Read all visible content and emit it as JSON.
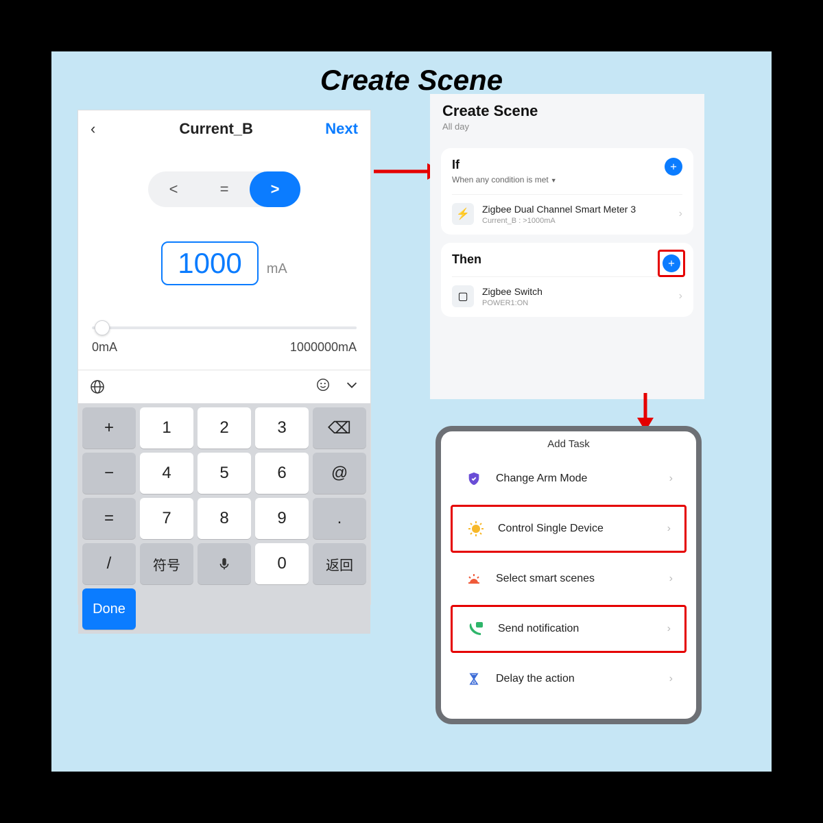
{
  "main_title": "Create Scene",
  "left": {
    "back": "‹",
    "title": "Current_B",
    "next": "Next",
    "ops": {
      "lt": "<",
      "eq": "=",
      "gt": ">"
    },
    "value": "1000",
    "unit": "mA",
    "min": "0mA",
    "max": "1000000mA",
    "kb": {
      "plus": "+",
      "minus": "−",
      "eq": "=",
      "slash": "/",
      "k1": "1",
      "k2": "2",
      "k3": "3",
      "k4": "4",
      "k5": "5",
      "k6": "6",
      "k7": "7",
      "k8": "8",
      "k9": "9",
      "k0": "0",
      "bksp": "⌫",
      "at": "@",
      "dot": ".",
      "symbolic_cn": "符号",
      "return_cn": "返回",
      "mic": "🎤",
      "done": "Done",
      "globe": "🌐",
      "smile": "☺",
      "chev": "⌄"
    }
  },
  "scene": {
    "title": "Create Scene",
    "subtitle": "All day",
    "if_label": "If",
    "if_cond": "When any condition is met",
    "device1_title": "Zigbee Dual Channel Smart Meter 3",
    "device1_sub": "Current_B : >1000mA",
    "then_label": "Then",
    "device2_title": "Zigbee Switch",
    "device2_sub": "POWER1:ON",
    "chev": "›"
  },
  "tasks": {
    "title": "Add Task",
    "arm": "Change Arm Mode",
    "control": "Control Single Device",
    "smart": "Select smart scenes",
    "notify": "Send notification",
    "delay": "Delay the action",
    "chev": "›"
  }
}
